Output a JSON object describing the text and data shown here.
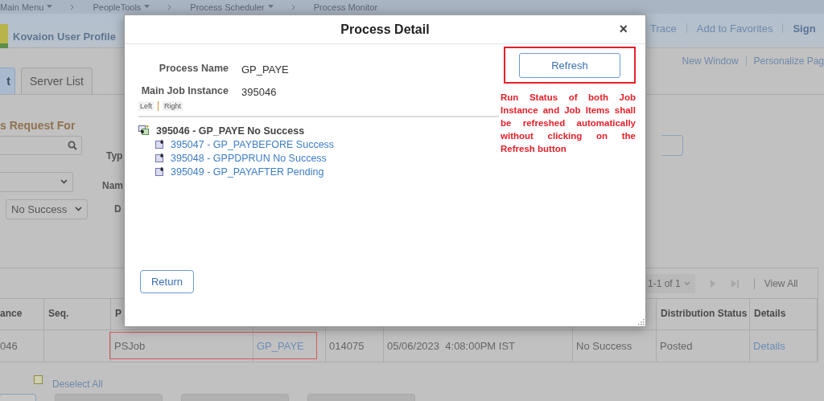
{
  "breadcrumb": [
    {
      "label": "Main Menu",
      "dropdown": true
    },
    {
      "label": "PeopleTools",
      "dropdown": true
    },
    {
      "label": "Process Scheduler",
      "dropdown": true
    },
    {
      "label": "Process Monitor",
      "dropdown": false
    }
  ],
  "header": {
    "title": "Kovaion User Profile",
    "links": [
      "Trace",
      "Add to Favorites",
      "Sign"
    ]
  },
  "page_links": [
    "New Window",
    "Personalize Pag"
  ],
  "tabs": [
    {
      "label": "t",
      "selected": true
    },
    {
      "label": "Server List",
      "selected": false
    }
  ],
  "filter": {
    "heading": "s Request For",
    "type_label": "Typ",
    "name_label": "Nam",
    "date_label": "D",
    "run_status": "No Success"
  },
  "table": {
    "pager": "1-1 of 1",
    "view_all": "View All",
    "columns": [
      "ance",
      "Seq.",
      "P",
      "Distribution Status",
      "Details"
    ],
    "rows": [
      {
        "column_1": "046",
        "column_3": "PSJob",
        "column_4": "GP_PAYE",
        "column_5": "014075",
        "column_6": "05/06/2023  4:08:00PM IST",
        "column_7": "No Success",
        "distribution_status": "Posted",
        "details": "Details"
      }
    ]
  },
  "select_all": {
    "checked": false,
    "label": "Deselect All"
  },
  "modal": {
    "title": "Process Detail",
    "close": "×",
    "fields": [
      {
        "label": "Process Name",
        "value": "GP_PAYE"
      },
      {
        "label": "Main Job Instance",
        "value": "395046"
      }
    ],
    "view_tabs": [
      "Left",
      "Right"
    ],
    "tree": {
      "label": "395046 - GP_PAYE No Success",
      "children": [
        {
          "label": "395047 - GP_PAYBEFORE Success"
        },
        {
          "label": "395048 - GPPDPRUN No Success"
        },
        {
          "label": "395049 - GP_PAYAFTER Pending"
        }
      ]
    },
    "refresh": "Refresh",
    "return": "Return",
    "annotation": "Run Status of both Job Instance and Job Items shall be refreshed automatically without clicking on the Refresh button"
  }
}
